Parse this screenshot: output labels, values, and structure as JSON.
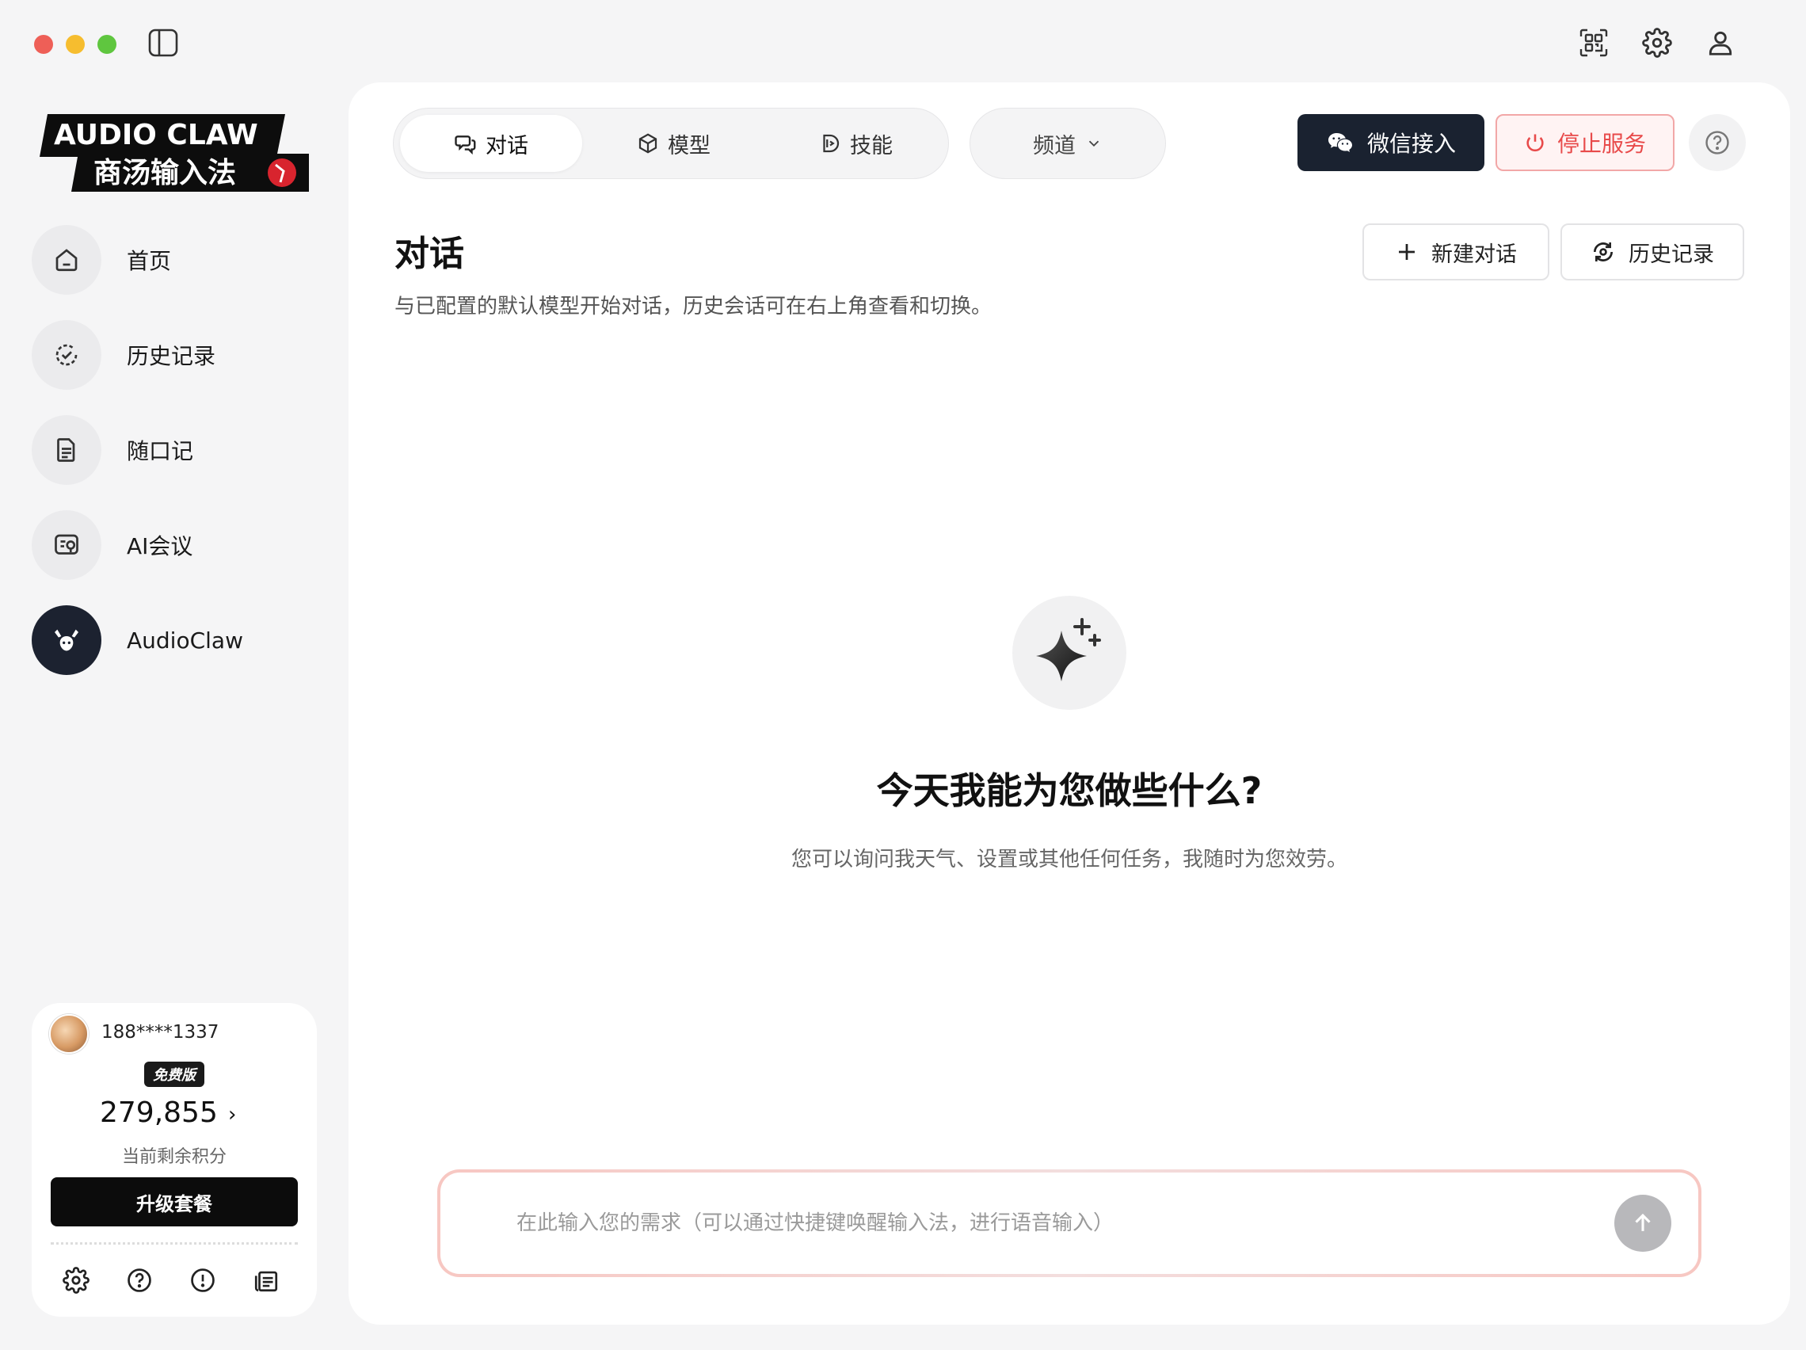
{
  "window": {
    "top_icons": [
      "qr-scan-icon",
      "gear-icon",
      "user-icon"
    ]
  },
  "brand": {
    "line1": "AUDIO CLAW",
    "line2": "商汤输入法"
  },
  "sidebar": {
    "items": [
      {
        "label": "首页",
        "icon": "home-icon",
        "active": false
      },
      {
        "label": "历史记录",
        "icon": "history-check-icon",
        "active": false
      },
      {
        "label": "随口记",
        "icon": "note-icon",
        "active": false
      },
      {
        "label": "AI会议",
        "icon": "meeting-icon",
        "active": false
      },
      {
        "label": "AudioClaw",
        "icon": "claw-icon",
        "active": true
      }
    ]
  },
  "user": {
    "phone": "188****1337",
    "plan_badge": "免费版",
    "points": "279,855",
    "points_arrow": "›",
    "points_label": "当前剩余积分",
    "upgrade_label": "升级套餐",
    "footer_icons": [
      "gear-icon",
      "help-icon",
      "info-icon",
      "log-icon"
    ]
  },
  "header": {
    "tabs": [
      {
        "label": "对话",
        "icon": "chat-icon",
        "active": true
      },
      {
        "label": "模型",
        "icon": "cube-icon",
        "active": false
      },
      {
        "label": "技能",
        "icon": "skill-icon",
        "active": false
      }
    ],
    "channel_label": "频道",
    "wechat_label": "微信接入",
    "stop_label": "停止服务"
  },
  "page": {
    "title": "对话",
    "description": "与已配置的默认模型开始对话，历史会话可在右上角查看和切换。",
    "new_chat_label": "新建对话",
    "history_label": "历史记录"
  },
  "hero": {
    "title": "今天我能为您做些什么?",
    "subtitle": "您可以询问我天气、设置或其他任何任务，我随时为您效劳。"
  },
  "input": {
    "placeholder": "在此输入您的需求（可以通过快捷键唤醒输入法，进行语音输入）",
    "value": ""
  },
  "colors": {
    "accent_dark": "#1a2230",
    "stop_red": "#e84a4a",
    "background": "#f5f5f6"
  }
}
